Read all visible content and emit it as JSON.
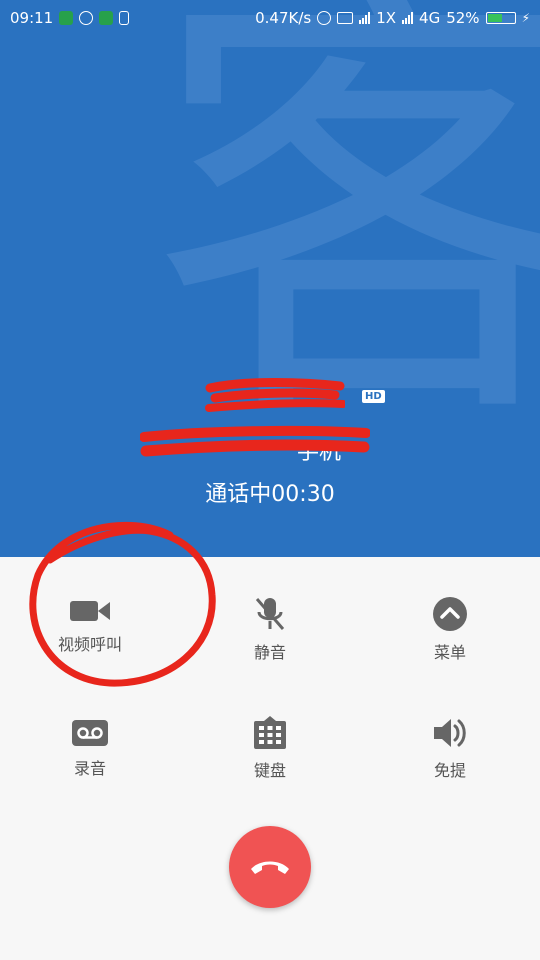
{
  "status_bar": {
    "time": "09:11",
    "network_speed": "0.47K/s",
    "sim1_label": "1X",
    "sim2_label": "4G",
    "battery": "52%"
  },
  "call": {
    "watermark_char": "客",
    "name": "",
    "hd_badge": "HD",
    "number_suffix": "手机",
    "status_time": "通话中00:30"
  },
  "actions": {
    "video_call": "视频呼叫",
    "mute": "静音",
    "menu": "菜单",
    "record": "录音",
    "keypad": "键盘",
    "speaker": "免提"
  },
  "colors": {
    "header_bg": "#2a72c0",
    "end_call": "#f05353",
    "annotation_red": "#e8261c"
  }
}
